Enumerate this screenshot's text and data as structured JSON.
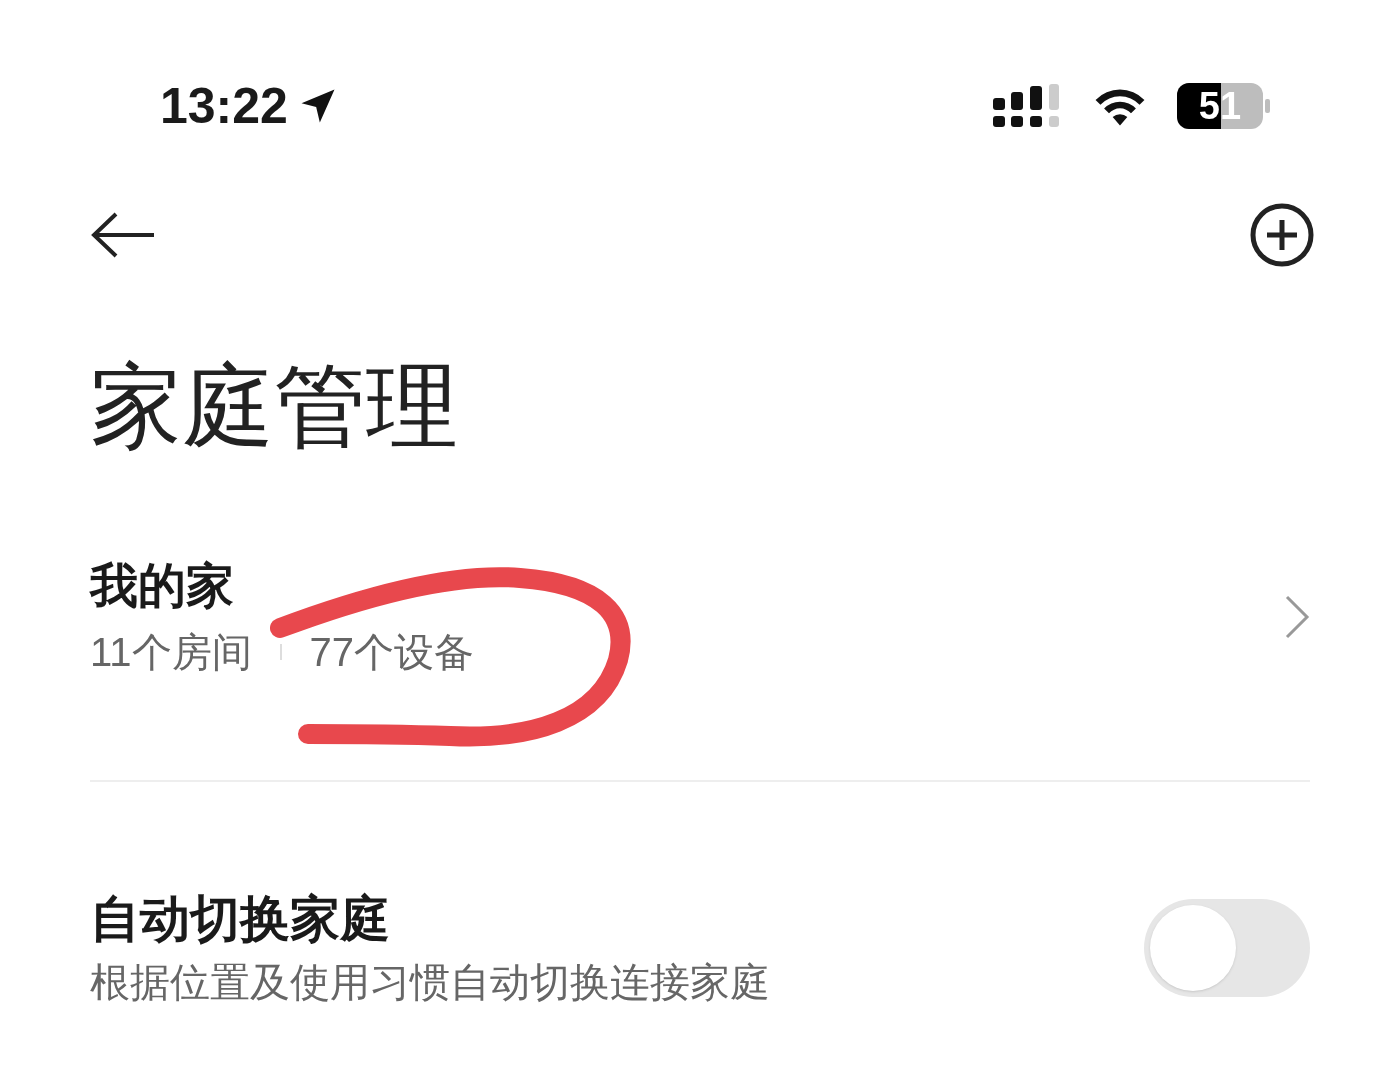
{
  "status_bar": {
    "time": "13:22",
    "battery": "51"
  },
  "header": {
    "title": "家庭管理"
  },
  "homes": [
    {
      "name": "我的家",
      "rooms": "11个房间",
      "devices": "77个设备"
    }
  ],
  "settings": [
    {
      "kind": "switch",
      "title": "自动切换家庭",
      "description": "根据位置及使用习惯自动切换连接家庭",
      "on": false
    }
  ]
}
